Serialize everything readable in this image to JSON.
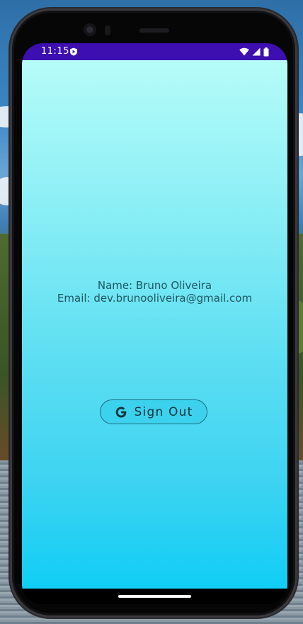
{
  "status_bar": {
    "time": "11:15",
    "app_icon": "play-protect-icon",
    "icons": [
      "wifi-icon",
      "signal-icon",
      "battery-icon"
    ],
    "color": "#3d0fb0"
  },
  "profile": {
    "name_line": "Name: Bruno Oliveira",
    "email_line": "Email: dev.brunooliveira@gmail.com"
  },
  "sign_out_button": {
    "label": "Sign Out",
    "icon": "google-g-icon"
  },
  "theme": {
    "gradient_top": "#b6fcf8",
    "gradient_bottom": "#10cdf5",
    "button_bg": "#3cd2ee",
    "text_color": "#1e5660"
  }
}
